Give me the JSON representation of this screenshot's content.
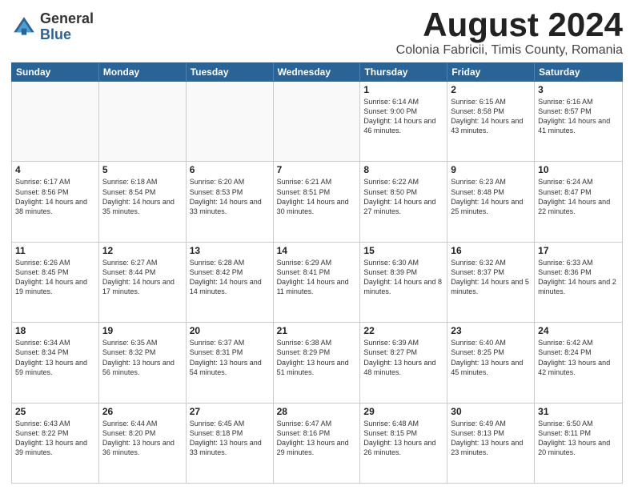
{
  "logo": {
    "general": "General",
    "blue": "Blue"
  },
  "title": "August 2024",
  "location": "Colonia Fabricii, Timis County, Romania",
  "days_of_week": [
    "Sunday",
    "Monday",
    "Tuesday",
    "Wednesday",
    "Thursday",
    "Friday",
    "Saturday"
  ],
  "weeks": [
    [
      {
        "day": "",
        "info": ""
      },
      {
        "day": "",
        "info": ""
      },
      {
        "day": "",
        "info": ""
      },
      {
        "day": "",
        "info": ""
      },
      {
        "day": "1",
        "info": "Sunrise: 6:14 AM\nSunset: 9:00 PM\nDaylight: 14 hours and 46 minutes."
      },
      {
        "day": "2",
        "info": "Sunrise: 6:15 AM\nSunset: 8:58 PM\nDaylight: 14 hours and 43 minutes."
      },
      {
        "day": "3",
        "info": "Sunrise: 6:16 AM\nSunset: 8:57 PM\nDaylight: 14 hours and 41 minutes."
      }
    ],
    [
      {
        "day": "4",
        "info": "Sunrise: 6:17 AM\nSunset: 8:56 PM\nDaylight: 14 hours and 38 minutes."
      },
      {
        "day": "5",
        "info": "Sunrise: 6:18 AM\nSunset: 8:54 PM\nDaylight: 14 hours and 35 minutes."
      },
      {
        "day": "6",
        "info": "Sunrise: 6:20 AM\nSunset: 8:53 PM\nDaylight: 14 hours and 33 minutes."
      },
      {
        "day": "7",
        "info": "Sunrise: 6:21 AM\nSunset: 8:51 PM\nDaylight: 14 hours and 30 minutes."
      },
      {
        "day": "8",
        "info": "Sunrise: 6:22 AM\nSunset: 8:50 PM\nDaylight: 14 hours and 27 minutes."
      },
      {
        "day": "9",
        "info": "Sunrise: 6:23 AM\nSunset: 8:48 PM\nDaylight: 14 hours and 25 minutes."
      },
      {
        "day": "10",
        "info": "Sunrise: 6:24 AM\nSunset: 8:47 PM\nDaylight: 14 hours and 22 minutes."
      }
    ],
    [
      {
        "day": "11",
        "info": "Sunrise: 6:26 AM\nSunset: 8:45 PM\nDaylight: 14 hours and 19 minutes."
      },
      {
        "day": "12",
        "info": "Sunrise: 6:27 AM\nSunset: 8:44 PM\nDaylight: 14 hours and 17 minutes."
      },
      {
        "day": "13",
        "info": "Sunrise: 6:28 AM\nSunset: 8:42 PM\nDaylight: 14 hours and 14 minutes."
      },
      {
        "day": "14",
        "info": "Sunrise: 6:29 AM\nSunset: 8:41 PM\nDaylight: 14 hours and 11 minutes."
      },
      {
        "day": "15",
        "info": "Sunrise: 6:30 AM\nSunset: 8:39 PM\nDaylight: 14 hours and 8 minutes."
      },
      {
        "day": "16",
        "info": "Sunrise: 6:32 AM\nSunset: 8:37 PM\nDaylight: 14 hours and 5 minutes."
      },
      {
        "day": "17",
        "info": "Sunrise: 6:33 AM\nSunset: 8:36 PM\nDaylight: 14 hours and 2 minutes."
      }
    ],
    [
      {
        "day": "18",
        "info": "Sunrise: 6:34 AM\nSunset: 8:34 PM\nDaylight: 13 hours and 59 minutes."
      },
      {
        "day": "19",
        "info": "Sunrise: 6:35 AM\nSunset: 8:32 PM\nDaylight: 13 hours and 56 minutes."
      },
      {
        "day": "20",
        "info": "Sunrise: 6:37 AM\nSunset: 8:31 PM\nDaylight: 13 hours and 54 minutes."
      },
      {
        "day": "21",
        "info": "Sunrise: 6:38 AM\nSunset: 8:29 PM\nDaylight: 13 hours and 51 minutes."
      },
      {
        "day": "22",
        "info": "Sunrise: 6:39 AM\nSunset: 8:27 PM\nDaylight: 13 hours and 48 minutes."
      },
      {
        "day": "23",
        "info": "Sunrise: 6:40 AM\nSunset: 8:25 PM\nDaylight: 13 hours and 45 minutes."
      },
      {
        "day": "24",
        "info": "Sunrise: 6:42 AM\nSunset: 8:24 PM\nDaylight: 13 hours and 42 minutes."
      }
    ],
    [
      {
        "day": "25",
        "info": "Sunrise: 6:43 AM\nSunset: 8:22 PM\nDaylight: 13 hours and 39 minutes."
      },
      {
        "day": "26",
        "info": "Sunrise: 6:44 AM\nSunset: 8:20 PM\nDaylight: 13 hours and 36 minutes."
      },
      {
        "day": "27",
        "info": "Sunrise: 6:45 AM\nSunset: 8:18 PM\nDaylight: 13 hours and 33 minutes."
      },
      {
        "day": "28",
        "info": "Sunrise: 6:47 AM\nSunset: 8:16 PM\nDaylight: 13 hours and 29 minutes."
      },
      {
        "day": "29",
        "info": "Sunrise: 6:48 AM\nSunset: 8:15 PM\nDaylight: 13 hours and 26 minutes."
      },
      {
        "day": "30",
        "info": "Sunrise: 6:49 AM\nSunset: 8:13 PM\nDaylight: 13 hours and 23 minutes."
      },
      {
        "day": "31",
        "info": "Sunrise: 6:50 AM\nSunset: 8:11 PM\nDaylight: 13 hours and 20 minutes."
      }
    ]
  ]
}
